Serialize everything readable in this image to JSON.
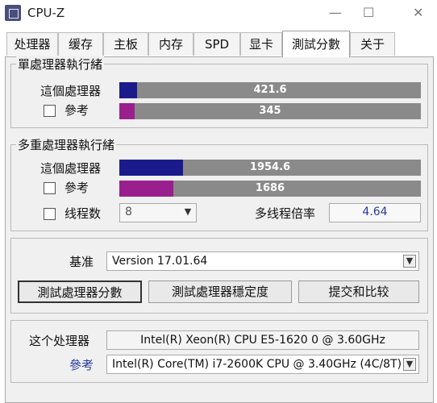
{
  "window": {
    "title": "CPU-Z",
    "controls": {
      "minimize": "—",
      "maximize": "☐",
      "close": "✕"
    }
  },
  "tabs": [
    {
      "label": "处理器"
    },
    {
      "label": "缓存"
    },
    {
      "label": "主板"
    },
    {
      "label": "内存"
    },
    {
      "label": "SPD"
    },
    {
      "label": "显卡"
    },
    {
      "label": "測試分數",
      "active": true
    },
    {
      "label": "关于"
    }
  ],
  "single": {
    "title": "單處理器執行緒",
    "this_label": "這個處理器",
    "this_value": "421.6",
    "this_fill": 0.06,
    "ref_label": "參考",
    "ref_value": "345",
    "ref_fill": 0.05
  },
  "multi": {
    "title": "多重處理器執行緒",
    "this_label": "這個處理器",
    "this_value": "1954.6",
    "this_fill": 0.21,
    "ref_label": "參考",
    "ref_value": "1686",
    "ref_fill": 0.18,
    "threads_label": "线程数",
    "threads_value": "8",
    "ratio_label": "多线程倍率",
    "ratio_value": "4.64"
  },
  "benchmark": {
    "label": "基准",
    "version": "Version 17.01.64",
    "btn_test": "測試處理器分數",
    "btn_stress": "測試處理器穩定度",
    "btn_submit": "提交和比较"
  },
  "cpu": {
    "this_label": "这个处理器",
    "this_value": "Intel(R) Xeon(R) CPU E5-1620 0 @ 3.60GHz",
    "ref_label": "參考",
    "ref_value": "Intel(R) Core(TM) i7-2600K CPU @ 3.40GHz (4C/8T)"
  },
  "colors": {
    "this_fill": "#1a1a8c",
    "ref_fill": "#9a1f8e",
    "bar_bg": "#8a8a8a"
  }
}
